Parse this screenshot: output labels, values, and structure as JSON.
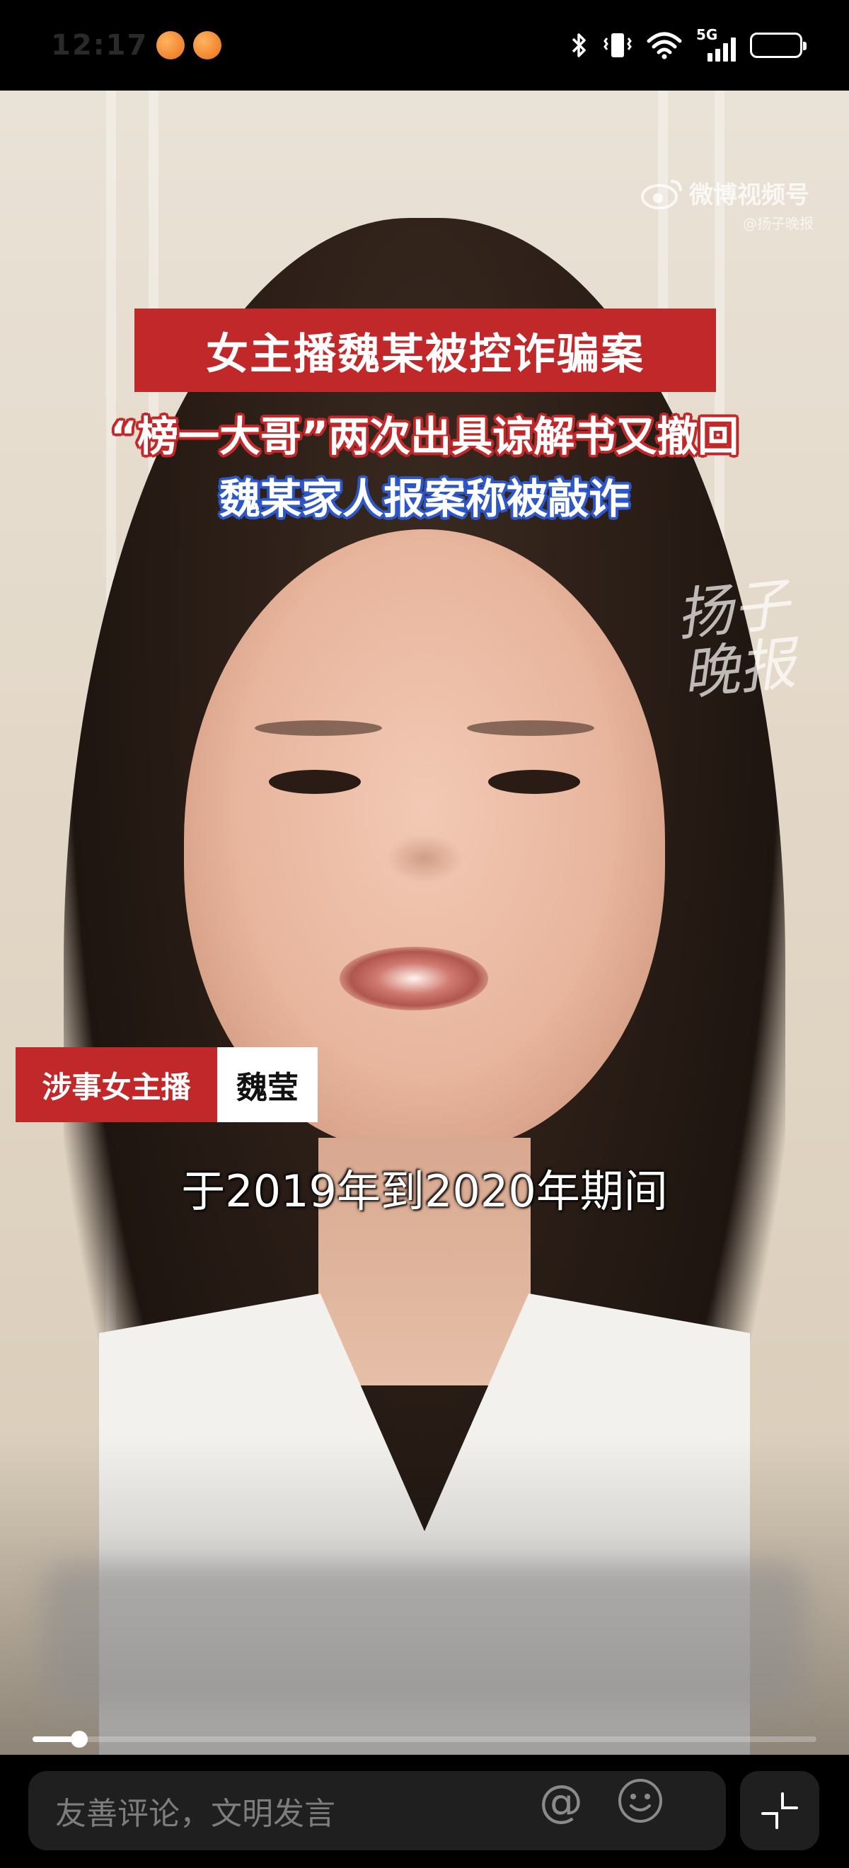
{
  "status_bar": {
    "time": "12:17",
    "network_label": "5G",
    "icons": [
      "bluetooth-icon",
      "vibrate-icon",
      "wifi-icon",
      "signal-icon",
      "battery-icon"
    ],
    "notification_icons": [
      "app-notification-icon",
      "app-notification-icon"
    ]
  },
  "video": {
    "watermark": {
      "brand": "微博视频号",
      "handle": "@扬子晚报",
      "logo_text": "扬子晚报"
    },
    "headline": "女主播魏某被控诈骗案",
    "subline_red": "“榜一大哥”两次出具谅解书又撤回",
    "subline_blue": "魏某家人报案称被敲诈",
    "name_tag": {
      "role": "涉事女主播",
      "name": "魏莹"
    },
    "caption": "于2019年到2020年期间",
    "progress": 0.06
  },
  "bottom_bar": {
    "comment_placeholder": "友善评论，文明发言",
    "at_icon_glyph": "@",
    "icons": [
      "at-icon",
      "emoji-icon",
      "collapse-icon"
    ]
  },
  "colors": {
    "headline_red": "#c0282a",
    "subline_blue": "#2d57c9",
    "bar_bg": "#1f1f1f"
  }
}
